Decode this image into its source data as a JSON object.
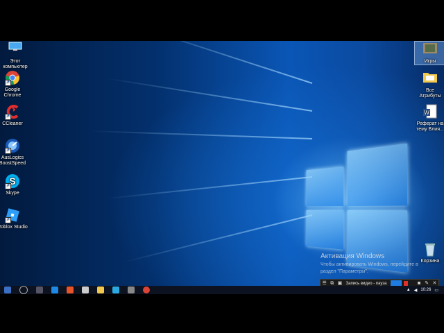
{
  "desktop_icons_left": [
    {
      "name": "this-pc",
      "label": "Этот компьютер"
    },
    {
      "name": "google-chrome",
      "label": "Google Chrome"
    },
    {
      "name": "ccleaner",
      "label": "CCleaner"
    },
    {
      "name": "auslogics-boostspeed",
      "label": "AusLogics BoostSpeed"
    },
    {
      "name": "skype",
      "label": "Skype"
    },
    {
      "name": "roblox-studio",
      "label": "Roblox Studio"
    }
  ],
  "desktop_icons_right": [
    {
      "name": "games",
      "label": "Игры"
    },
    {
      "name": "all-attributes",
      "label": "Все Атрибуты"
    },
    {
      "name": "report-doc",
      "label": "Реферат на тему Влия..."
    },
    {
      "name": "recycle-bin",
      "label": "Корзина"
    }
  ],
  "activation": {
    "title": "Активация Windows",
    "subtitle": "Чтобы активировать Windows, перейдите в раздел \"Параметры\"."
  },
  "recorder": {
    "status": "Запись видео - пауза"
  },
  "taskbar": {
    "clock": "10:26"
  },
  "colors": {
    "wallpaper_accent": "#0a56b6",
    "recorder_live": "#1f7be0",
    "recorder_stop": "#e0302a"
  }
}
